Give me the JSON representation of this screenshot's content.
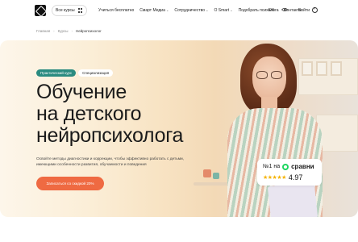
{
  "header": {
    "all_courses": "Все курсы",
    "nav": [
      {
        "label": "Учиться бесплатно",
        "dropdown": false
      },
      {
        "label": "Смарт Медиа",
        "dropdown": true
      },
      {
        "label": "Сотрудничество",
        "dropdown": true
      },
      {
        "label": "О Smart",
        "dropdown": true
      },
      {
        "label": "Подобрать психолога",
        "dropdown": false
      },
      {
        "label": "Контакты",
        "dropdown": false
      }
    ],
    "lang": "EN",
    "login": "Войти",
    "icons": {
      "logo": "brand-logo",
      "all_courses": "grid-icon",
      "eye": "eye-icon",
      "login": "login-icon"
    }
  },
  "breadcrumb": [
    "Главная",
    "Курсы",
    "Нейропсихолог"
  ],
  "hero": {
    "tags": [
      "Практический курс",
      "Специализация"
    ],
    "title_lines": [
      "Обучение",
      "на детского",
      "нейропсихолога"
    ],
    "description": "Освойте методы диагностики и коррекции, чтобы эффективно работать с детьми, имеющими особенности развития, обучаемости и поведения",
    "cta": "Записаться со скидкой 20%",
    "rating": {
      "prefix": "№1 на",
      "brand": "сравни",
      "score": "4.97",
      "stars": 5
    }
  },
  "colors": {
    "cta": "#ef6a42",
    "tag_practical": "#2a8b80",
    "brand_green": "#1ed760",
    "star": "#f5b301"
  }
}
